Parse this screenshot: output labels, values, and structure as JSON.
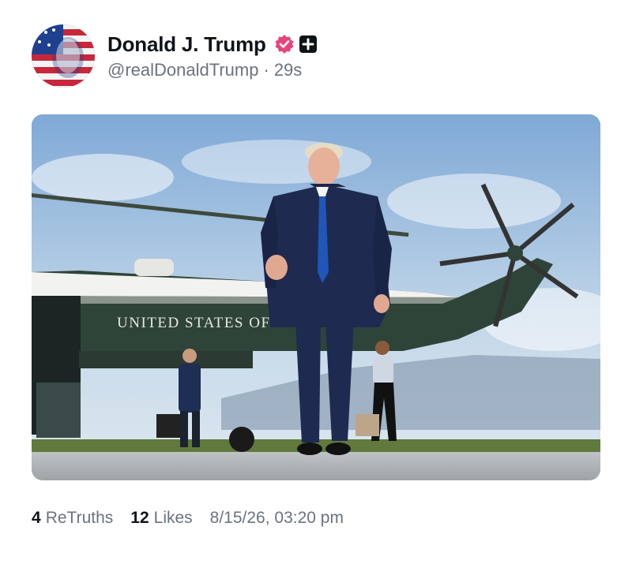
{
  "post": {
    "author": {
      "name": "Donald J. Trump",
      "handle": "@realDonaldTrump",
      "separator": "·",
      "time_ago": "29s",
      "verified_icon": "verified-badge-icon",
      "plus_icon": "plus-badge-icon",
      "avatar_icon": "avatar-flag-portrait"
    },
    "media": {
      "plane_text": "UNITED STATES OF AMERICA"
    },
    "stats": {
      "retruths_count": "4",
      "retruths_label": "ReTruths",
      "likes_count": "12",
      "likes_label": "Likes",
      "timestamp": "8/15/26, 03:20 pm"
    },
    "colors": {
      "verified": "#e5457a",
      "text": "#0f1419",
      "muted": "#6b7280"
    }
  }
}
